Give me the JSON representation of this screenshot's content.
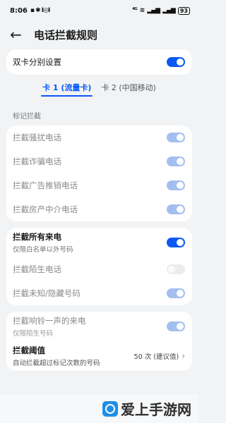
{
  "status_bar": {
    "time": "8:06",
    "left_icons": "⬛ ⦁ I0I",
    "right_icons": "4G 📶",
    "battery": "93"
  },
  "header": {
    "title": "电话拦截规则"
  },
  "dual_sim": {
    "label": "双卡分别设置",
    "on": true
  },
  "tabs": [
    {
      "label": "卡 1 (流量卡)",
      "active": true
    },
    {
      "label": "卡 2 (中国移动)",
      "active": false
    }
  ],
  "section_label": "标记拦截",
  "marked": [
    {
      "label": "拦截骚扰电话"
    },
    {
      "label": "拦截诈骗电话"
    },
    {
      "label": "拦截广告推销电话"
    },
    {
      "label": "拦截房产中介电话"
    }
  ],
  "block_all": {
    "label": "拦截所有来电",
    "sub": "仅限白名单以外号码"
  },
  "block_strangers": {
    "label": "拦截陌生电话"
  },
  "block_unknown": {
    "label": "拦截未知/隐藏号码"
  },
  "one_ring": {
    "label": "拦截响铃一声的来电",
    "sub": "仅限陌生号码"
  },
  "threshold": {
    "label": "拦截阈值",
    "sub": "自动拦截超过标记次数的号码",
    "value": "50 次 (建议值)"
  },
  "watermark": {
    "text": "爱上手游网"
  }
}
